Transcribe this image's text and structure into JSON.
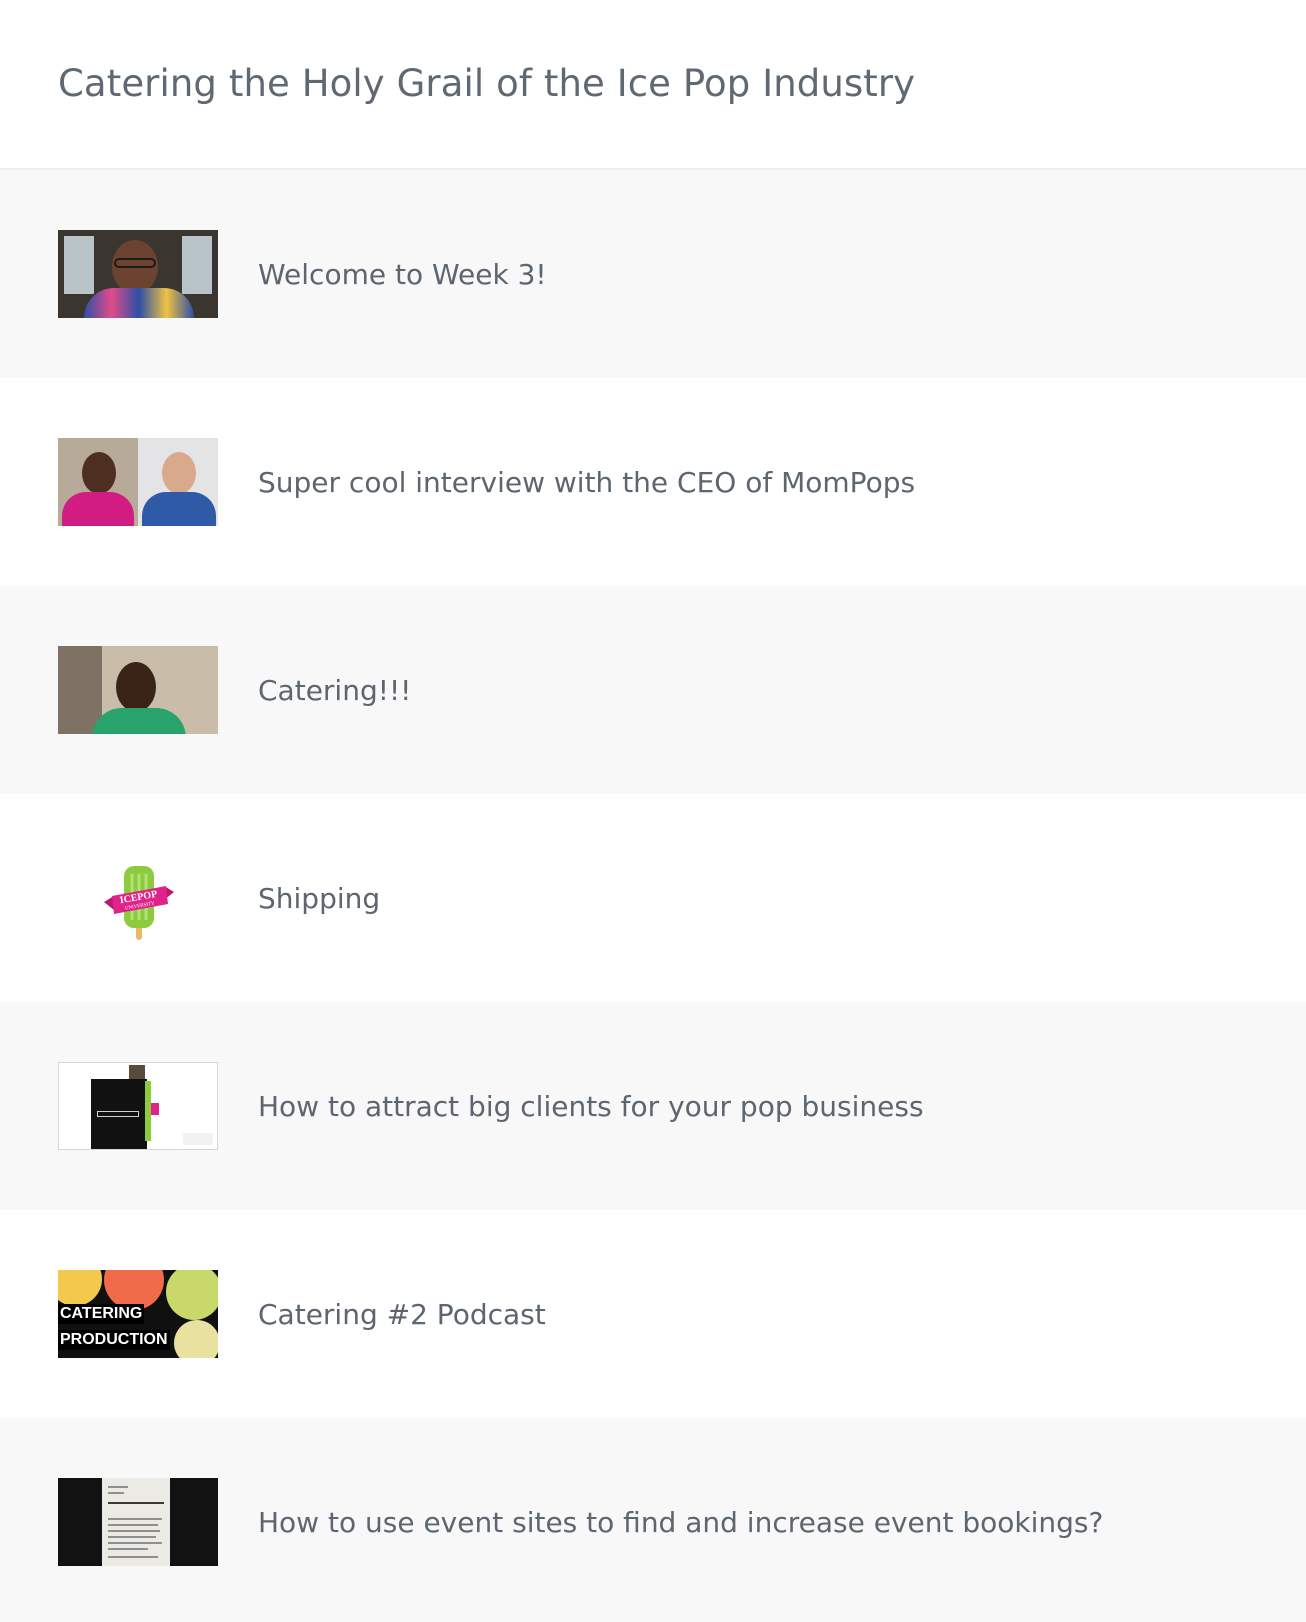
{
  "header": {
    "title": "Catering the Holy Grail of the Ice Pop Industry"
  },
  "lessons": [
    {
      "title": "Welcome to Week 3!",
      "thumbnail": "video-thumbnail-host-speaking"
    },
    {
      "title": "Super cool interview with the CEO of MomPops",
      "thumbnail": "video-thumbnail-two-person-interview"
    },
    {
      "title": "Catering!!!",
      "thumbnail": "video-thumbnail-host-green-shirt"
    },
    {
      "title": "Shipping",
      "thumbnail": "icepop-university-logo",
      "logo_text": [
        "ICEPOP",
        "UNIVERSITY"
      ]
    },
    {
      "title": "How to attract big clients for your pop business",
      "thumbnail": "slide-presentation-thumbnail"
    },
    {
      "title": "Catering #2 Podcast",
      "thumbnail": "citrus-podcast-cover",
      "cover_text": [
        "CATERING",
        "PRODUCTION"
      ]
    },
    {
      "title": "How to use event sites to find and increase event bookings?",
      "thumbnail": "document-screen-thumbnail"
    }
  ],
  "colors": {
    "title_text": "#5f6973",
    "row_shaded": "#f8f8f8",
    "row_plain": "#ffffff",
    "divider": "#eceef0",
    "brand_pink": "#e0238a",
    "brand_green": "#8ccc3c"
  }
}
